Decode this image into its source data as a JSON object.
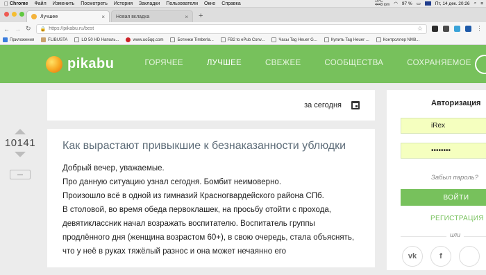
{
  "menubar": {
    "items": [
      "Chrome",
      "Файл",
      "Изменить",
      "Посмотреть",
      "История",
      "Закладки",
      "Пользователи",
      "Окно",
      "Справка"
    ],
    "temp": "14°C",
    "speed": "4443 rpm",
    "battery": "97 %",
    "datetime": "Пт, 14 дек.  20:26"
  },
  "tabs": [
    {
      "title": "Лучшее",
      "close": "×"
    },
    {
      "title": "Новая вкладка",
      "close": "×"
    }
  ],
  "newtab": "+",
  "address": {
    "url": "https://pikabu.ru/best"
  },
  "bookmarks": [
    "Приложения",
    "FLIBUSTA",
    "LO 50 HD Наполь...",
    "www.uo5qq.com",
    "Ботинки Timberla...",
    "FB2 to ePub Conv...",
    "Часы Tag Heuer G...",
    "Купить Tag Heuer ...",
    "Контроллер NM8..."
  ],
  "site": {
    "logo": "pikabu",
    "nav": [
      "ГОРЯЧЕЕ",
      "ЛУЧШЕЕ",
      "СВЕЖЕЕ",
      "СООБЩЕСТВА",
      "СОХРАНЯЕМОЕ"
    ],
    "more": "•••"
  },
  "period": {
    "label": "за сегодня"
  },
  "story": {
    "rating": "10141",
    "title": "Как вырастают привыкшие к безнаказанности ублюдки",
    "body": [
      "Добрый вечер, уважаемые.",
      "Про данную ситуацию узнал сегодня. Бомбит неимоверно.",
      "Произошло всё в одной из гимназий Красногвардейского района СПб.",
      "В столовой, во время обеда первоклашек, на просьбу отойти с прохода, девятиклассник начал возражать воспитателю. Воспитатель группы продлённого дня (женщина возрастом 60+), в свою очередь, стала объяснять, что у неё в руках тяжёлый разнос и она может нечаянно его"
    ]
  },
  "auth": {
    "title": "Авторизация",
    "username": "iRex",
    "password": "••••••••",
    "forgot": "Забыл пароль?",
    "login": "ВОЙТИ",
    "register": "РЕГИСТРАЦИЯ",
    "or": "или",
    "social": [
      "vk",
      "f"
    ]
  },
  "colors": {
    "brand_green": "#77c15c",
    "autofill": "#f5ffbf"
  }
}
